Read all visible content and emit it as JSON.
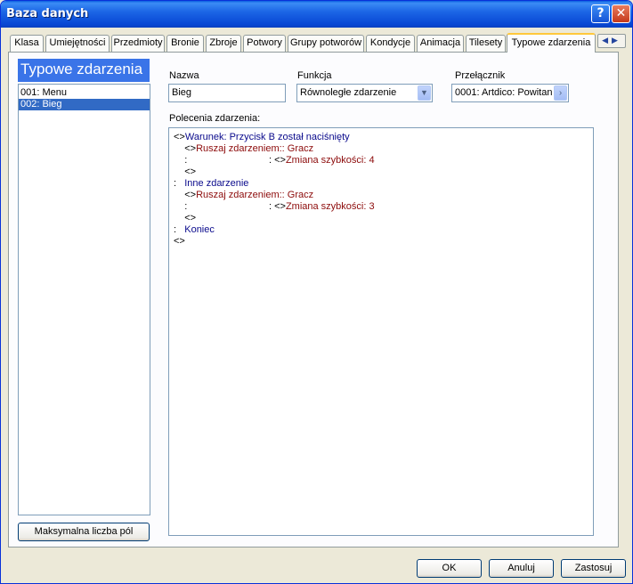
{
  "window": {
    "title": "Baza danych"
  },
  "tabs": [
    {
      "label": "Klasa"
    },
    {
      "label": "Umiejętności"
    },
    {
      "label": "Przedmioty"
    },
    {
      "label": "Bronie"
    },
    {
      "label": "Zbroje"
    },
    {
      "label": "Potwory"
    },
    {
      "label": "Grupy potworów"
    },
    {
      "label": "Kondycje"
    },
    {
      "label": "Animacja"
    },
    {
      "label": "Tilesety"
    },
    {
      "label": "Typowe zdarzenia"
    }
  ],
  "left_panel": {
    "header": "Typowe zdarzenia",
    "items": [
      {
        "label": "001: Menu"
      },
      {
        "label": "002: Bieg"
      }
    ],
    "max_button": "Maksymalna liczba pól"
  },
  "form": {
    "name_label": "Nazwa",
    "name_value": "Bieg",
    "function_label": "Funkcja",
    "function_value": "Równoległe zdarzenie",
    "switch_label": "Przełącznik",
    "switch_value": "0001: Artdico: Powitan",
    "commands_label": "Polecenia zdarzenia:"
  },
  "commands": [
    {
      "prefix": "<>",
      "text": "Warunek: Przycisk B został naciśnięty",
      "color": "blue"
    },
    {
      "prefix": "    <>",
      "text": "Ruszaj zdarzeniem:: Gracz",
      "color": "red"
    },
    {
      "prefix": "    :                              : <>",
      "text": "Zmiana szybkości: 4",
      "color": "red"
    },
    {
      "prefix": "    <>",
      "text": "",
      "color": "black"
    },
    {
      "prefix": ":   ",
      "text": "Inne zdarzenie",
      "color": "blue"
    },
    {
      "prefix": "    <>",
      "text": "Ruszaj zdarzeniem:: Gracz",
      "color": "red"
    },
    {
      "prefix": "    :                              : <>",
      "text": "Zmiana szybkości: 3",
      "color": "red"
    },
    {
      "prefix": "    <>",
      "text": "",
      "color": "black"
    },
    {
      "prefix": ":   ",
      "text": "Koniec",
      "color": "blue"
    },
    {
      "prefix": "<>",
      "text": "",
      "color": "black"
    }
  ],
  "footer": {
    "ok": "OK",
    "cancel": "Anuluj",
    "apply": "Zastosuj"
  }
}
